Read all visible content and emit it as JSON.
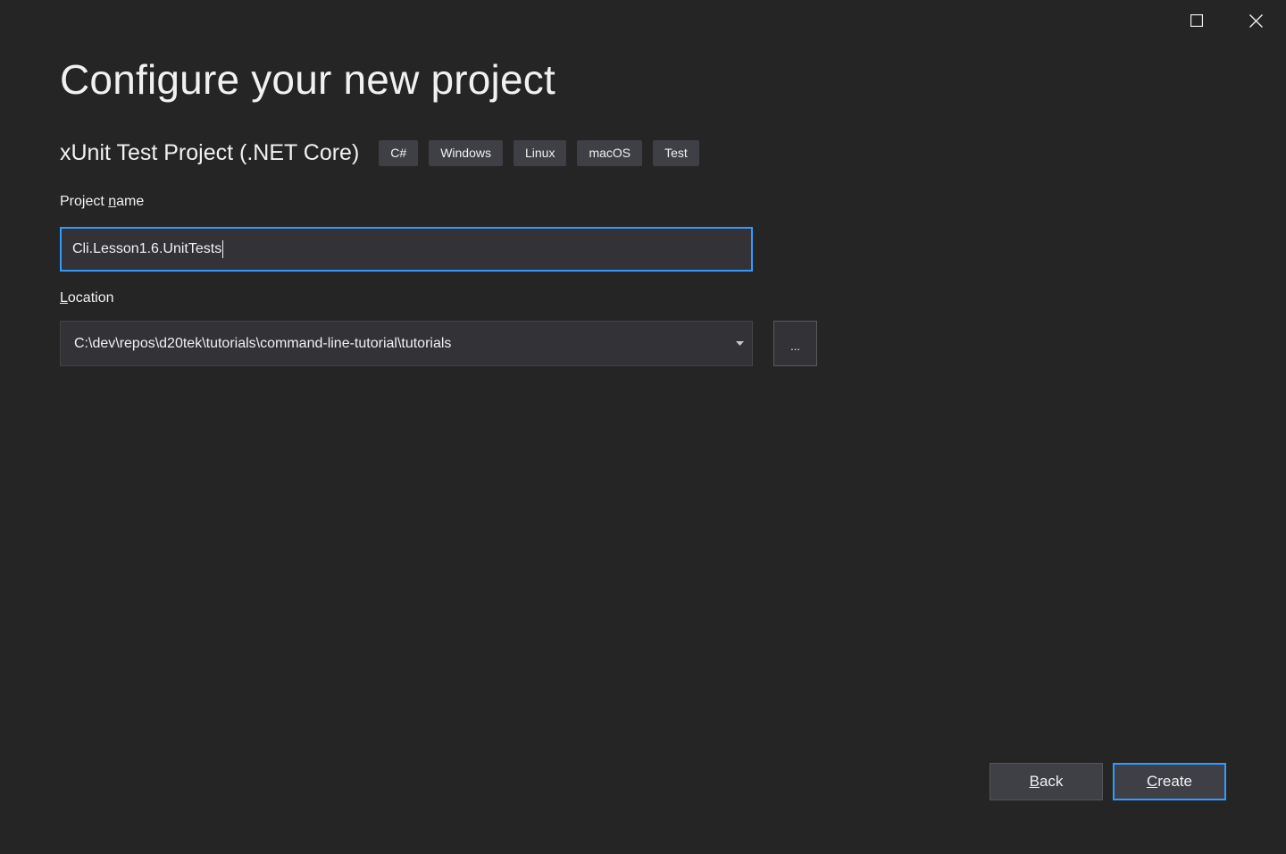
{
  "window": {
    "maximize_icon": "maximize-icon",
    "close_icon": "close-icon"
  },
  "page": {
    "title": "Configure your new project"
  },
  "template": {
    "name": "xUnit Test Project (.NET Core)",
    "tags": [
      "C#",
      "Windows",
      "Linux",
      "macOS",
      "Test"
    ]
  },
  "project_name": {
    "label_prefix": "Project ",
    "label_access": "n",
    "label_suffix": "ame",
    "value": "Cli.Lesson1.6.UnitTests"
  },
  "location": {
    "label_access": "L",
    "label_suffix": "ocation",
    "value": "C:\\dev\\repos\\d20tek\\tutorials\\command-line-tutorial\\tutorials",
    "browse_label": "..."
  },
  "buttons": {
    "back_access": "B",
    "back_suffix": "ack",
    "create_access": "C",
    "create_suffix": "reate"
  },
  "colors": {
    "background": "#252526",
    "accent": "#3399ff",
    "input_bg": "#333337",
    "tag_bg": "#3f3f46"
  }
}
